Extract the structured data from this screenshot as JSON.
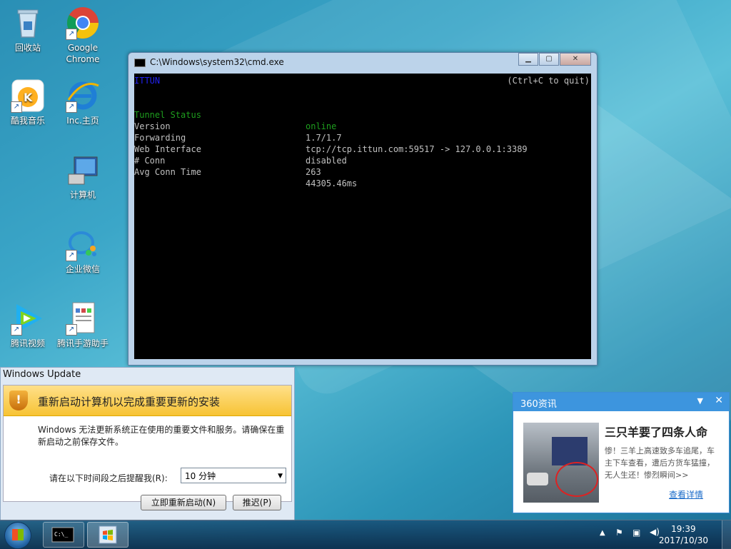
{
  "desktop": {
    "icons": [
      {
        "label": "回收站"
      },
      {
        "label": "Google Chrome"
      },
      {
        "label": "酷我音乐"
      },
      {
        "label": "Inc.主页"
      },
      {
        "label": "计算机"
      },
      {
        "label": "企业微信"
      },
      {
        "label": "腾讯视频"
      },
      {
        "label": "腾讯手游助手"
      }
    ]
  },
  "cmd": {
    "title": "C:\\Windows\\system32\\cmd.exe",
    "header_left": "ITTUN",
    "header_right": "(Ctrl+C to quit)",
    "rows": [
      {
        "key": "Tunnel Status",
        "value": "online"
      },
      {
        "key": "Version",
        "value": "1.7/1.7"
      },
      {
        "key": "Forwarding",
        "value": "tcp://tcp.ittun.com:59517 -> 127.0.0.1:3389"
      },
      {
        "key": "Web Interface",
        "value": "disabled"
      },
      {
        "key": "# Conn",
        "value": "263"
      },
      {
        "key": "Avg Conn Time",
        "value": "44305.46ms"
      }
    ],
    "colors": {
      "header": "#2222ee",
      "status": "#1e9e1e",
      "text": "#c0c0c0"
    }
  },
  "update": {
    "title": "Windows Update",
    "heading": "重新启动计算机以完成重要更新的安装",
    "message": "Windows 无法更新系统正在使用的重要文件和服务。请确保在重新启动之前保存文件。",
    "remind_label": "请在以下时间段之后提醒我(R):",
    "remind_value": "10 分钟",
    "restart_button": "立即重新启动(N)",
    "postpone_button": "推迟(P)"
  },
  "news": {
    "header": "360资讯",
    "headline": "三只羊要了四条人命",
    "summary": "惨！三羊上高速致多车追尾，车主下车查看，遭后方货车猛撞，无人生还！惨烈瞬间>>",
    "link": "查看详情"
  },
  "taskbar": {
    "time": "19:39",
    "date": "2017/10/30"
  }
}
